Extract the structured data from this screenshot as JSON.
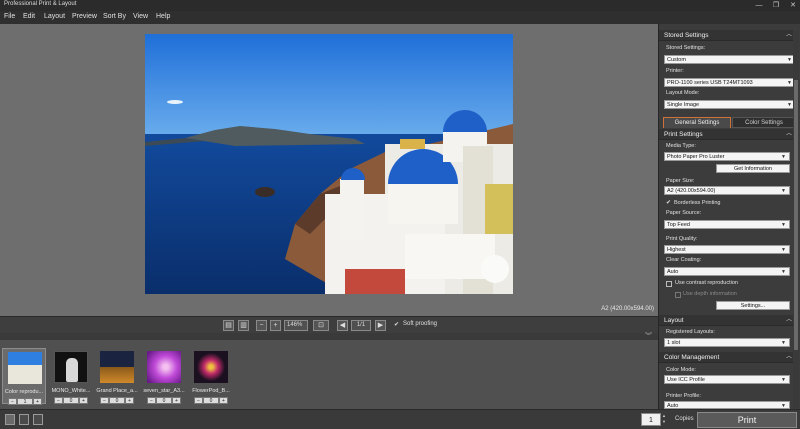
{
  "window": {
    "title": "Professional Print & Layout",
    "minimize": "—",
    "maximize": "❐",
    "close": "✕"
  },
  "menu": [
    "File",
    "Edit",
    "Layout",
    "Preview",
    "Sort By",
    "View",
    "Help"
  ],
  "preview": {
    "paper_size_label": "A2 (420.00x594.00)"
  },
  "toolbar": {
    "zoom_value": "146%",
    "page_indicator": "1/1",
    "soft_proofing_label": "Soft proofing",
    "soft_proofing_checked": true
  },
  "thumbnails": [
    {
      "label": "Color reprodu...",
      "count": "1",
      "selected": true
    },
    {
      "label": "MONO_White...",
      "count": "0",
      "selected": false
    },
    {
      "label": "Grand Place_a...",
      "count": "0",
      "selected": false
    },
    {
      "label": "seven_star_A3...",
      "count": "0",
      "selected": false
    },
    {
      "label": "FlowerPod_B...",
      "count": "0",
      "selected": false
    }
  ],
  "stored_settings": {
    "header": "Stored Settings",
    "stored_label": "Stored Settings:",
    "stored_value": "Custom",
    "printer_label": "Printer:",
    "printer_value": "PRO-1100 series USB T24MT1093",
    "layout_mode_label": "Layout Mode:",
    "layout_mode_value": "Single Image"
  },
  "tabs": {
    "general": "General Settings",
    "color": "Color Settings"
  },
  "print_settings": {
    "header": "Print Settings",
    "media_type_label": "Media Type:",
    "media_type_value": "Photo Paper Pro Luster",
    "get_info_button": "Get Information",
    "paper_size_label": "Paper Size:",
    "paper_size_value": "A2 (420.00x594.00)",
    "borderless_label": "Borderless Printing",
    "paper_source_label": "Paper Source:",
    "paper_source_value": "Top Feed",
    "print_quality_label": "Print Quality:",
    "print_quality_value": "Highest",
    "clear_coating_label": "Clear Coating:",
    "clear_coating_value": "Auto",
    "contrast_label": "Use contrast reproduction",
    "depth_label": "Use depth information",
    "settings_button": "Settings..."
  },
  "layout_section": {
    "header": "Layout",
    "registered_label": "Registered Layouts:",
    "registered_value": "1 slot"
  },
  "color_management": {
    "header": "Color Management",
    "color_mode_label": "Color Mode:",
    "color_mode_value": "Use ICC Profile",
    "printer_profile_label": "Printer Profile:",
    "printer_profile_value": "Auto"
  },
  "status": {
    "copies_value": "1",
    "copies_label": "Copies",
    "print_button": "Print"
  },
  "colors": {
    "accent_tab_border": "#d0733a",
    "sky": "#2f7fe0",
    "sea": "#0f3f8f",
    "dome": "#1e5fc8"
  }
}
